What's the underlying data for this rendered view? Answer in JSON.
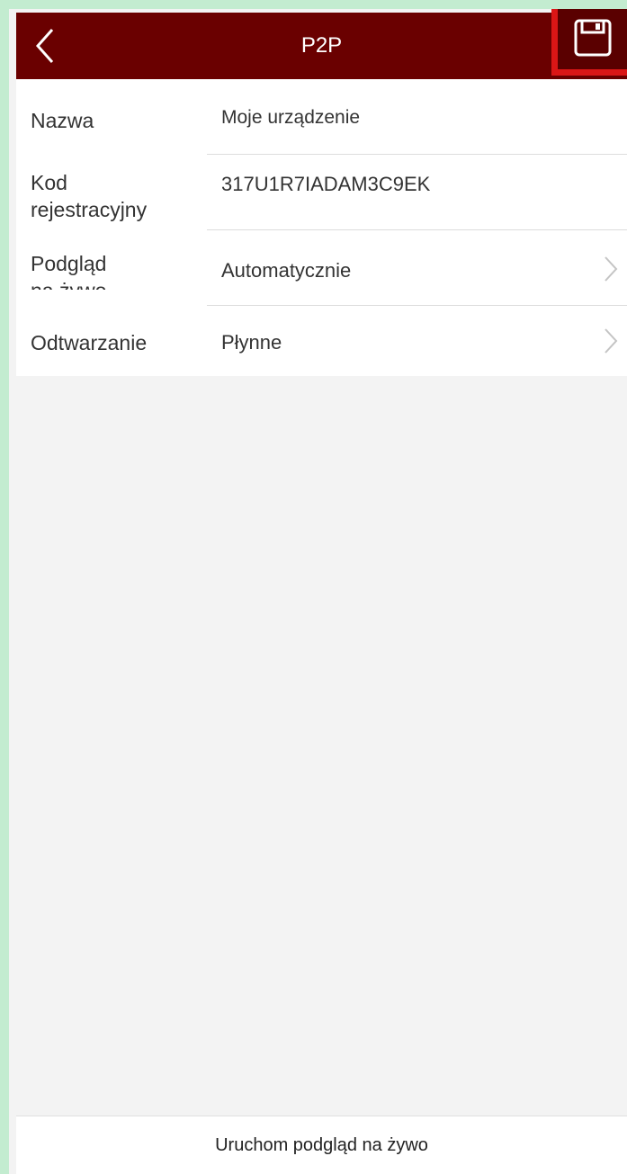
{
  "header": {
    "title": "P2P",
    "back_icon": "chevron-left-icon",
    "save_icon": "floppy-disk-icon",
    "background": "#6a0000",
    "highlight_color": "#da1616"
  },
  "settings": {
    "name": {
      "label": "Nazwa",
      "value": "Moje urządzenie"
    },
    "registration_code": {
      "label_line1": "Kod",
      "label_line2": "rejestracyjny",
      "value": "317U1R7IADAM3C9EK"
    },
    "live_view": {
      "label_line1": "Podgląd",
      "label_line2": "na żywo",
      "value": "Automatycznie"
    },
    "playback": {
      "label": "Odtwarzanie",
      "value": "Płynne"
    }
  },
  "footer": {
    "start_live_view_label": "Uruchom podgląd na żywo"
  }
}
